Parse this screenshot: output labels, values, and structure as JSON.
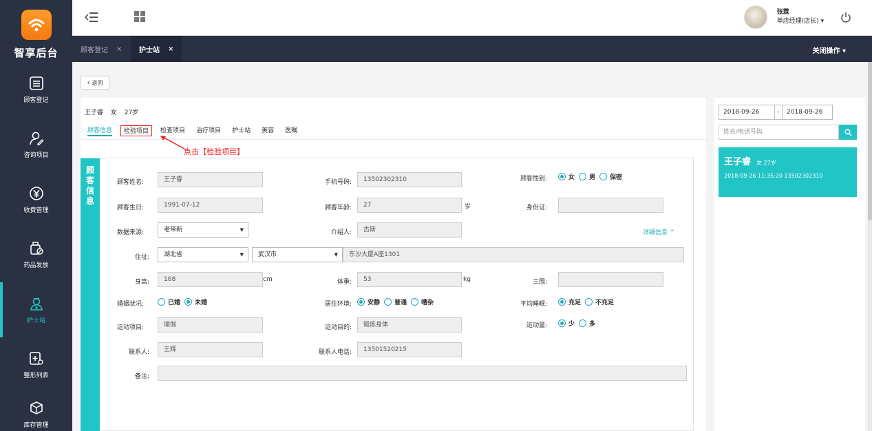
{
  "app": {
    "title": "智享后台"
  },
  "sidebar": {
    "items": [
      {
        "label": "顾客登记",
        "icon": "list-icon"
      },
      {
        "label": "咨询项目",
        "icon": "user-edit-icon"
      },
      {
        "label": "收费管理",
        "icon": "yen-icon"
      },
      {
        "label": "药品发放",
        "icon": "medicine-icon"
      },
      {
        "label": "护士站",
        "icon": "nurse-icon"
      },
      {
        "label": "整形列表",
        "icon": "plus-user-icon"
      },
      {
        "label": "库存管理",
        "icon": "box-icon"
      }
    ]
  },
  "header": {
    "user_name": "张霖",
    "user_role": "单店经理(店长) ▾"
  },
  "tabs": [
    {
      "label": "顾客登记",
      "close": "×"
    },
    {
      "label": "护士站",
      "close": "×"
    }
  ],
  "close_ops": "关闭操作 ▾",
  "back_label": "返回",
  "patient": {
    "name": "王子睿",
    "gender": "女",
    "age": "27岁"
  },
  "subtabs": [
    "顾客信息",
    "检验项目",
    "检查项目",
    "治疗项目",
    "护士站",
    "美容",
    "医嘱"
  ],
  "annotation": "点击【检验项目】",
  "section_title": [
    "顾",
    "客",
    "信",
    "息"
  ],
  "form": {
    "name_label": "顾客姓名:",
    "name": "王子睿",
    "phone_label": "手机号码:",
    "phone": "13502302310",
    "gender_label": "顾客性别:",
    "gender_opts": [
      "女",
      "男",
      "保密"
    ],
    "birth_label": "顾客生日:",
    "birth": "1991-07-12",
    "age_label": "顾客年龄:",
    "age": "27",
    "age_unit": "岁",
    "id_label": "身份证:",
    "source_label": "数据来源:",
    "source": "老带新",
    "referrer_label": "介绍人:",
    "referrer": "古斯",
    "detail_link": "详细信息 ^",
    "addr_label": "住址:",
    "province": "湖北省",
    "city": "武汉市",
    "address": "东沙大厦A座1301",
    "height_label": "身高:",
    "height": "168",
    "height_unit": "cm",
    "weight_label": "体重:",
    "weight": "53",
    "weight_unit": "kg",
    "measure_label": "三围:",
    "marital_label": "婚姻状况:",
    "marital_opts": [
      "已婚",
      "未婚"
    ],
    "env_label": "居住环境:",
    "env_opts": [
      "安静",
      "普通",
      "嘈杂"
    ],
    "sleep_label": "平均睡眠:",
    "sleep_opts": [
      "充足",
      "不充足"
    ],
    "sport_label": "运动项目:",
    "sport": "瑜伽",
    "purpose_label": "运动目的:",
    "purpose": "锻炼身体",
    "amount_label": "运动量:",
    "amount_opts": [
      "少",
      "多"
    ],
    "contact_label": "联系人:",
    "contact": "王辉",
    "contact_phone_label": "联系人电话:",
    "contact_phone": "13501520215",
    "note_label": "备注:"
  },
  "right": {
    "date_from": "2018-09-26",
    "date_sep": "-",
    "date_to": "2018-09-26",
    "search_placeholder": "姓名/电话号码",
    "card_name": "王子睿",
    "card_meta": "女   27岁",
    "card_sub": "2018-09-26 11:35:20 13502302310"
  },
  "colors": {
    "accent": "#22c5c6",
    "sidebar": "#2a3142",
    "annotation": "#e22222"
  }
}
